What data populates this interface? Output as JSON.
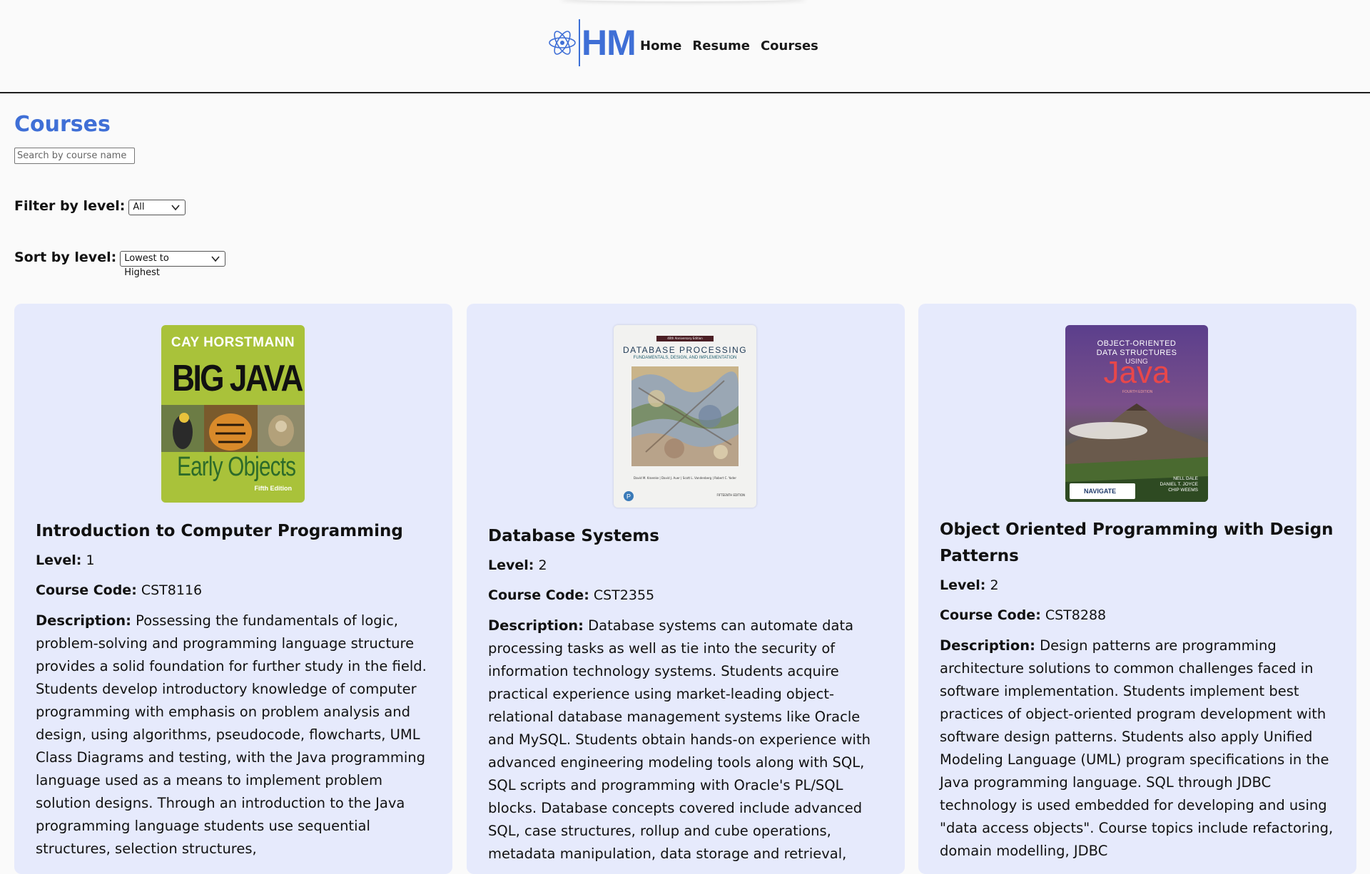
{
  "header": {
    "brand": "HM",
    "nav": [
      {
        "label": "Home"
      },
      {
        "label": "Resume"
      },
      {
        "label": "Courses"
      }
    ],
    "accent_color": "#3f6fd6"
  },
  "page": {
    "title": "Courses",
    "search": {
      "placeholder": "Search by course name",
      "value": ""
    },
    "filter": {
      "label": "Filter by level:",
      "selected": "All"
    },
    "sort": {
      "label": "Sort by level:",
      "selected": "Lowest to Highest"
    }
  },
  "labels": {
    "level": "Level:",
    "course_code": "Course Code:",
    "description": "Description:"
  },
  "courses": [
    {
      "title": "Introduction to Computer Programming",
      "level": "1",
      "code": "CST8116",
      "description": "Possessing the fundamentals of logic, problem-solving and programming language structure provides a solid foundation for further study in the field. Students develop introductory knowledge of computer programming with emphasis on problem analysis and design, using algorithms, pseudocode, flowcharts, UML Class Diagrams and testing, with the Java programming language used as a means to implement problem solution designs. Through an introduction to the Java programming language students use sequential structures, selection structures,",
      "cover": {
        "author": "CAY HORSTMANN",
        "title": "BIG JAVA",
        "subtitle": "Early Objects",
        "edition": "Fifth Edition",
        "color": "#a9c23a"
      }
    },
    {
      "title": "Database Systems",
      "level": "2",
      "code": "CST2355",
      "description": "Database systems can automate data processing tasks as well as tie into the security of information technology systems. Students acquire practical experience using market-leading object-relational database management systems like Oracle and MySQL. Students obtain hands-on experience with advanced engineering modeling tools along with SQL, SQL scripts and programming with Oracle's PL/SQL blocks. Database concepts covered include advanced SQL, case structures, rollup and cube operations, metadata manipulation, data storage and retrieval,",
      "cover": {
        "banner": "40th Anniversary Edition",
        "title": "DATABASE PROCESSING",
        "subtitle": "FUNDAMENTALS, DESIGN, AND IMPLEMENTATION",
        "authors": "David M. Kroenke | David J. Auer | Scott L. Vandenberg | Robert C. Yoder",
        "edition": "FIFTEENTH EDITION",
        "color": "#f2f2f2"
      }
    },
    {
      "title": "Object Oriented Programming with Design Patterns",
      "level": "2",
      "code": "CST8288",
      "description": "Design patterns are programming architecture solutions to common challenges faced in software implementation. Students implement best practices of object-oriented program development with software design patterns. Students also apply Unified Modeling Language (UML) program specifications in the Java programming language. SQL through JDBC technology is used embedded for developing and using \"data access objects\". Course topics include refactoring, domain modelling, JDBC",
      "cover": {
        "line1": "OBJECT-ORIENTED",
        "line2": "DATA STRUCTURES",
        "line3": "USING",
        "title": "Java",
        "edition": "FOURTH EDITION",
        "authors": "NELL DALE\nDANIEL T. JOYCE\nCHIP WEEMS",
        "badge": "NAVIGATE",
        "color": "#5b3f8c"
      }
    }
  ]
}
